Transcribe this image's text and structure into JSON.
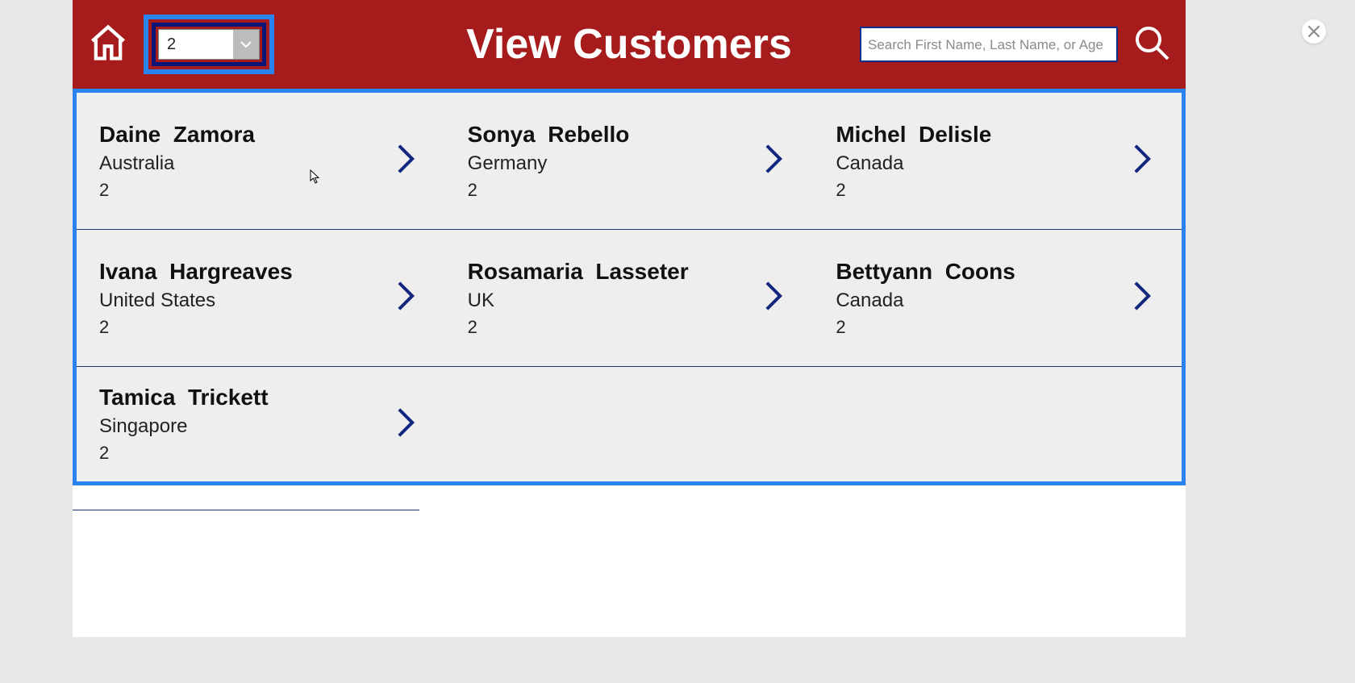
{
  "header": {
    "title": "View Customers",
    "dropdown_value": "2",
    "search_placeholder": "Search First Name, Last Name, or Age"
  },
  "customers": [
    {
      "first": "Daine",
      "last": "Zamora",
      "country": "Australia",
      "age": "2"
    },
    {
      "first": "Sonya",
      "last": "Rebello",
      "country": "Germany",
      "age": "2"
    },
    {
      "first": "Michel",
      "last": "Delisle",
      "country": "Canada",
      "age": "2"
    },
    {
      "first": "Ivana",
      "last": "Hargreaves",
      "country": "United States",
      "age": "2"
    },
    {
      "first": "Rosamaria",
      "last": "Lasseter",
      "country": "UK",
      "age": "2"
    },
    {
      "first": "Bettyann",
      "last": "Coons",
      "country": "Canada",
      "age": "2"
    },
    {
      "first": "Tamica",
      "last": "Trickett",
      "country": "Singapore",
      "age": "2"
    }
  ],
  "colors": {
    "accent": "#a61c1c",
    "highlight": "#2a84ef",
    "chevron": "#14277e"
  }
}
